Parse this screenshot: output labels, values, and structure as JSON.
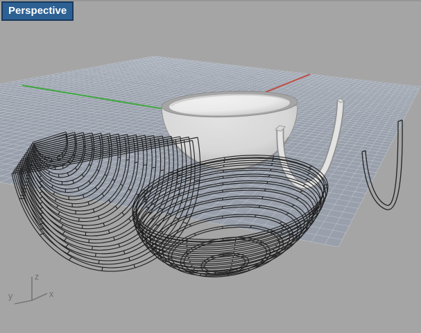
{
  "viewport": {
    "tab_label": "Perspective",
    "background_color": "#a5a5a5",
    "top_edge_color": "#8a8a8a",
    "tab": {
      "bg_color": "#2d6194",
      "border_color": "#16395d",
      "text_color": "#ffffff"
    }
  },
  "grid": {
    "plane_color": "#99a0ab",
    "minor_line_color": "rgba(230,235,244,0.5)",
    "divisions": 60
  },
  "axes": {
    "x_color": "#c04a40",
    "y_color": "#3fa63f"
  },
  "gizmo": {
    "color": "#6f6f6f",
    "z_label": "z",
    "y_label": "y",
    "x_label": "x"
  },
  "objects": {
    "wireframe_color": "#191919",
    "bowl_fill": "#d7d7d7",
    "bowl_rim_color": "#a5a5a5",
    "bowl_inner_color": "#e9e9e9",
    "handle_fill": "#e3e3e3",
    "handle_edge_color": "#8f8f8f"
  }
}
